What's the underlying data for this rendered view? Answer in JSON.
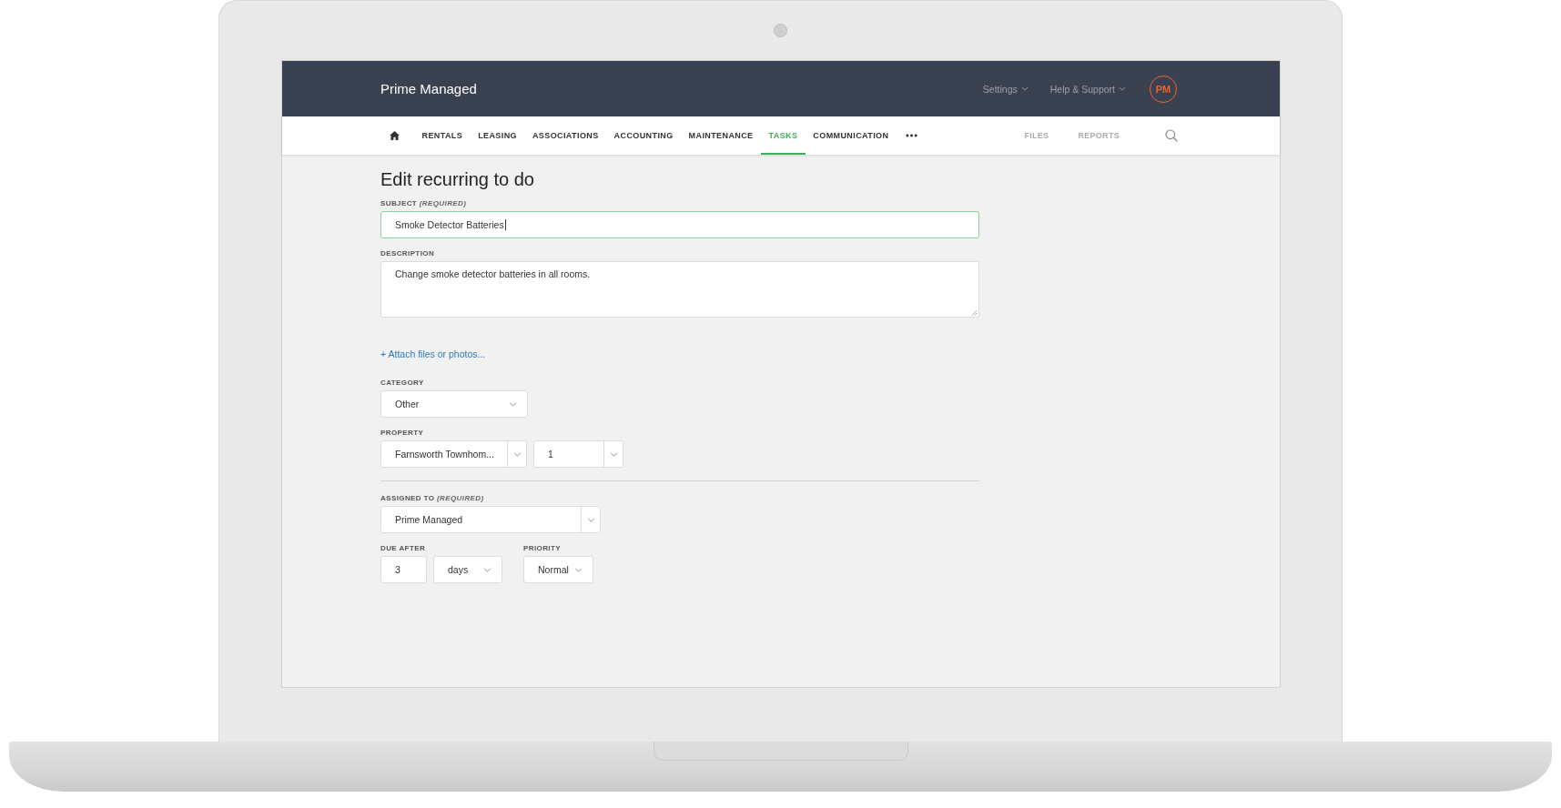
{
  "app": {
    "title": "Prime Managed",
    "menus": [
      {
        "label": "Settings"
      },
      {
        "label": "Help & Support"
      }
    ],
    "avatar": "PM"
  },
  "nav": {
    "items": [
      {
        "label": "RENTALS",
        "selected": false
      },
      {
        "label": "LEASING",
        "selected": false
      },
      {
        "label": "ASSOCIATIONS",
        "selected": false
      },
      {
        "label": "ACCOUNTING",
        "selected": false
      },
      {
        "label": "MAINTENANCE",
        "selected": false
      },
      {
        "label": "TASKS",
        "selected": true
      },
      {
        "label": "COMMUNICATION",
        "selected": false
      }
    ],
    "secondary": [
      {
        "label": "FILES"
      },
      {
        "label": "REPORTS"
      }
    ]
  },
  "form": {
    "title": "Edit recurring to do",
    "fields": [
      {
        "kind": "text",
        "label": "SUBJECT",
        "note": "(REQUIRED)",
        "value": "Smoke Detector Batteries",
        "focused": true
      },
      {
        "kind": "textarea",
        "label": "DESCRIPTION",
        "value": "Change smoke detector batteries in all rooms."
      },
      {
        "kind": "link",
        "text": "+ Attach files or photos..."
      },
      {
        "kind": "select",
        "label": "CATEGORY",
        "value": "Other"
      },
      {
        "kind": "select_pair",
        "label": "PROPERTY",
        "values": [
          "Farnsworth Townhom...",
          "1"
        ]
      },
      {
        "kind": "divider"
      },
      {
        "kind": "split_select",
        "label": "ASSIGNED TO",
        "note": "(REQUIRED)",
        "value": "Prime Managed"
      },
      {
        "kind": "due_priority",
        "due": {
          "label": "DUE AFTER",
          "amount": "3",
          "unit": "days"
        },
        "priority": {
          "label": "PRIORITY",
          "value": "Normal"
        }
      }
    ]
  }
}
